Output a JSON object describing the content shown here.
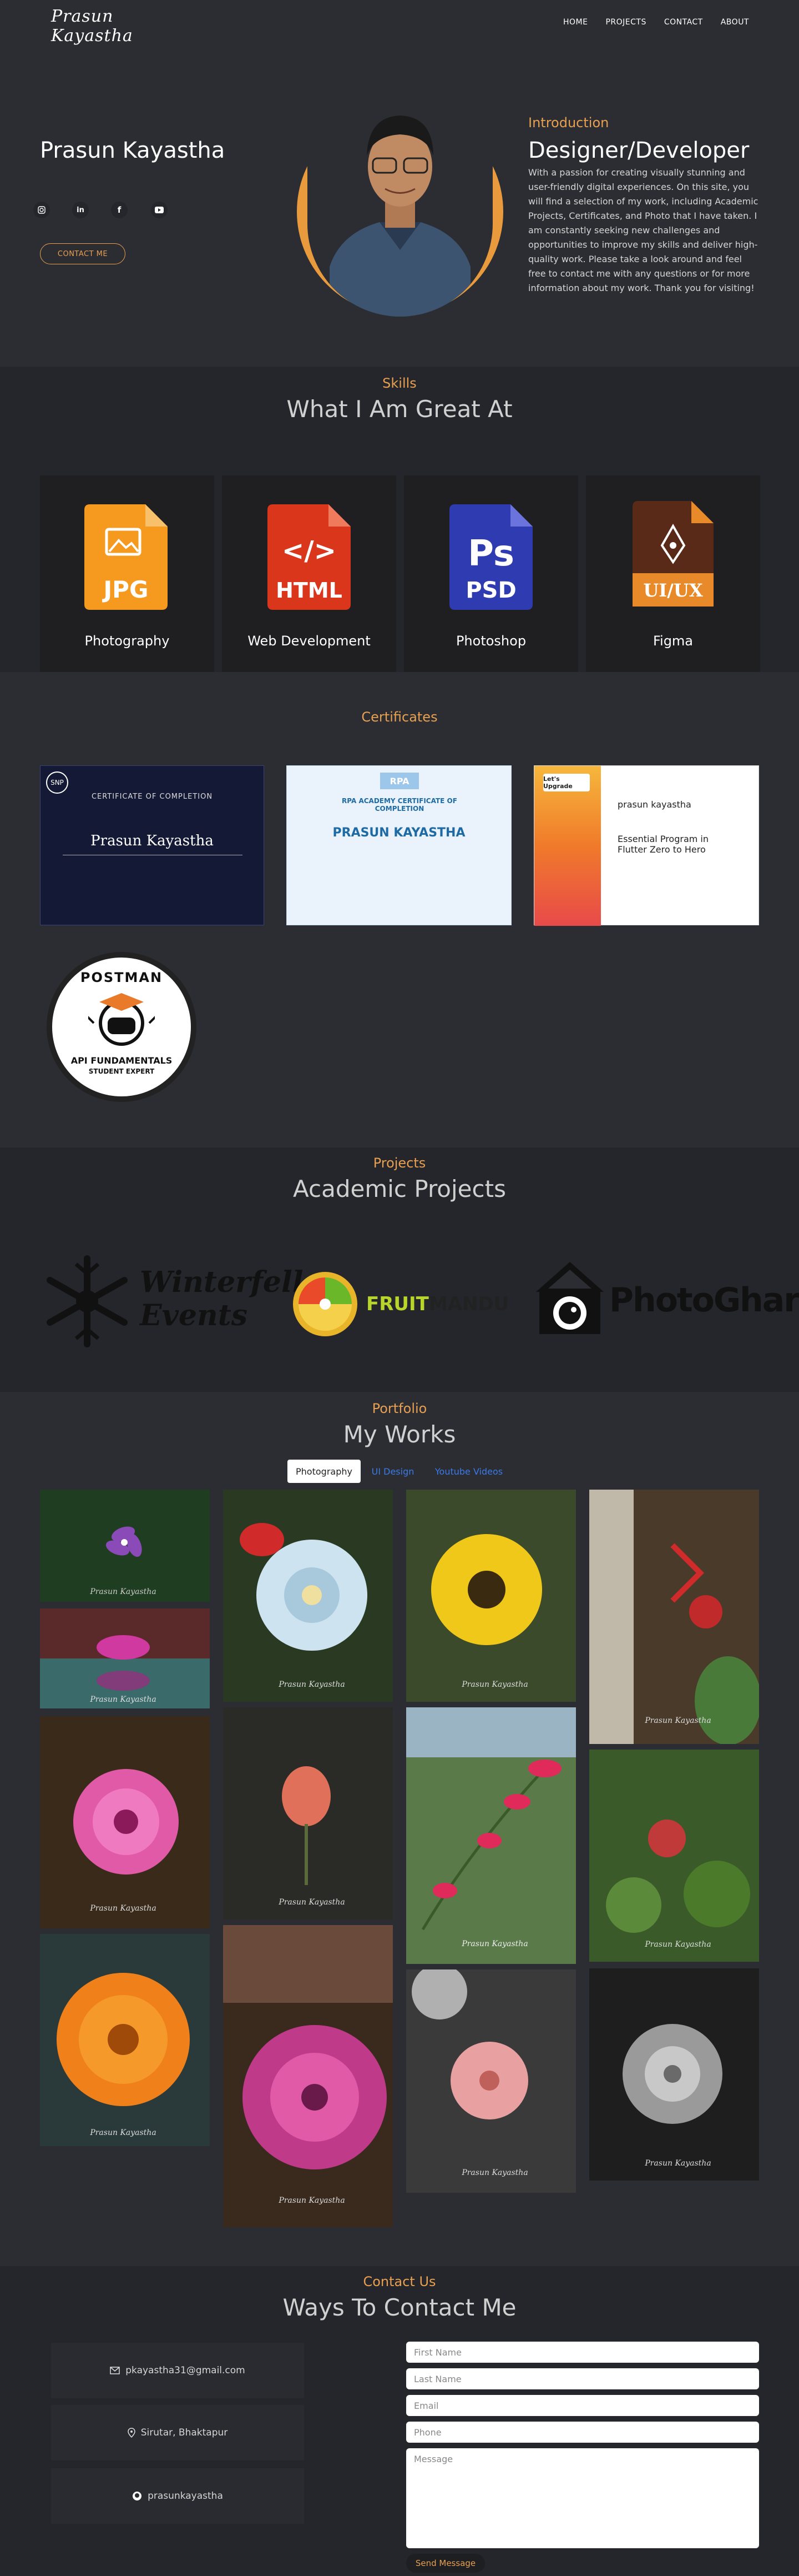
{
  "nav": {
    "logo": "Prasun Kayastha",
    "links": [
      "HOME",
      "PROJECTS",
      "CONTACT",
      "ABOUT"
    ]
  },
  "hero": {
    "name": "Prasun Kayastha",
    "contact_button": "CONTACT ME",
    "social": [
      "instagram-icon",
      "linkedin-icon",
      "facebook-icon",
      "youtube-icon"
    ],
    "intro_label": "Introduction",
    "intro_title": "Designer/Developer",
    "intro_text": "With a passion for creating visually stunning and user-friendly digital experiences. On this site, you will find a selection of my work, including Academic Projects, Certificates, and Photo that I have taken. I am constantly seeking new challenges and opportunities to improve my skills and deliver high-quality work. Please take a look around and feel free to contact me with any questions or for more information about my work. Thank you for visiting!"
  },
  "skills": {
    "label": "Skills",
    "title": "What I Am Great At",
    "items": [
      {
        "name": "Photography",
        "icon_text": "JPG",
        "color": "#f59a1f"
      },
      {
        "name": "Web Development",
        "icon_text": "HTML",
        "color": "#d9361c"
      },
      {
        "name": "Photoshop",
        "icon_text": "PSD",
        "color": "#2f3bb0"
      },
      {
        "name": "Figma",
        "icon_text": "UI/UX",
        "color": "#5a2a18"
      }
    ]
  },
  "certificates": {
    "label": "Certificates",
    "items": [
      {
        "heading": "CERTIFICATE OF COMPLETION",
        "name": "Prasun Kayastha",
        "org": "SNP"
      },
      {
        "heading": "RPA ACADEMY CERTIFICATE OF COMPLETION",
        "name": "PRASUN KAYASTHA",
        "org": "RPA"
      },
      {
        "heading": "Essential Program in Flutter Zero to Hero",
        "name": "prasun kayastha",
        "org": "Let's Upgrade"
      }
    ],
    "badge": {
      "top": "POSTMAN",
      "bottom": "API FUNDAMENTALS",
      "sub": "STUDENT EXPERT"
    }
  },
  "projects": {
    "label": "Projects",
    "title": "Academic Projects",
    "items": [
      {
        "l1": "Winterfell",
        "l2": "Events"
      },
      {
        "a": "FRUIT",
        "b": "MANDU"
      },
      {
        "t": "PhotoGhar"
      }
    ]
  },
  "portfolio": {
    "label": "Portfolio",
    "title": "My Works",
    "tabs": [
      "Photography",
      "UI Design",
      "Youtube Videos"
    ],
    "active_tab": "Photography",
    "watermark": "Prasun Kayastha"
  },
  "contact": {
    "label": "Contact Us",
    "title": "Ways To Contact Me",
    "email": "pkayastha31@gmail.com",
    "location": "Sirutar, Bhaktapur",
    "github": "prasunkayastha",
    "fields": {
      "first": "First Name",
      "last": "Last Name",
      "email": "Email",
      "phone": "Phone",
      "message": "Message"
    },
    "send": "Send Message"
  }
}
